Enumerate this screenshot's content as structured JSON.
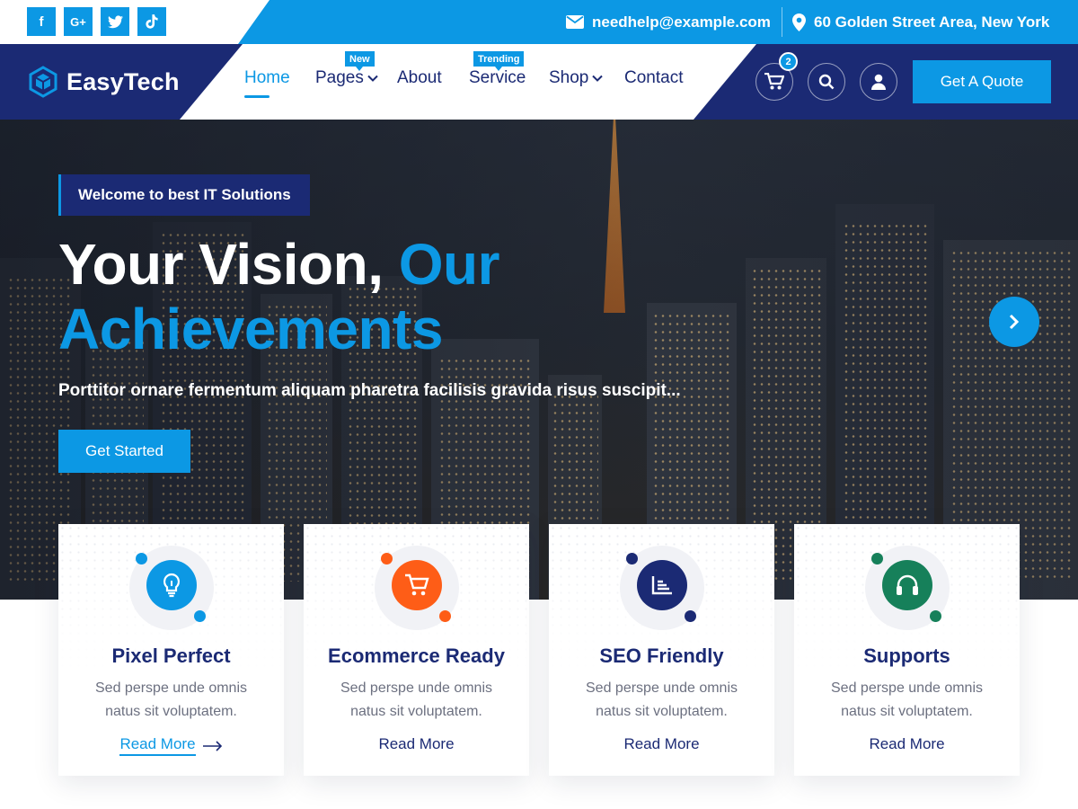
{
  "topbar": {
    "social_icons": [
      "facebook-icon",
      "google-plus-icon",
      "twitter-icon",
      "tiktok-icon"
    ],
    "social_labels": {
      "facebook": "f",
      "google": "G+"
    },
    "email": "needhelp@example.com",
    "address": "60 Golden Street Area, New York"
  },
  "nav": {
    "logo_text": "EasyTech",
    "items": [
      {
        "label": "Home",
        "active": true
      },
      {
        "label": "Pages",
        "badge": "New",
        "dropdown": true
      },
      {
        "label": "About"
      },
      {
        "label": "Service",
        "badge": "Trending"
      },
      {
        "label": "Shop",
        "dropdown": true
      },
      {
        "label": "Contact"
      }
    ],
    "cart_count": "2",
    "quote_button": "Get A Quote"
  },
  "hero": {
    "badge": "Welcome to best IT Solutions",
    "headline_white": "Your Vision,",
    "headline_blue_1": "Our",
    "headline_blue_2": "Achievements",
    "subtitle": "Porttitor ornare fermentum aliquam pharetra facilisis gravida risus suscipit...",
    "cta": "Get Started"
  },
  "features": [
    {
      "title": "Pixel Perfect",
      "desc": "Sed perspe unde omnis natus sit voluptatem.",
      "link": "Read More",
      "icon": "lightbulb-icon",
      "color": "#0c98e4"
    },
    {
      "title": "Ecommerce Ready",
      "desc": "Sed perspe unde omnis natus sit voluptatem.",
      "link": "Read More",
      "icon": "cart-icon",
      "color": "#fe5d17"
    },
    {
      "title": "SEO Friendly",
      "desc": "Sed perspe unde omnis natus sit voluptatem.",
      "link": "Read More",
      "icon": "chart-icon",
      "color": "#1b2a74"
    },
    {
      "title": "Supports",
      "desc": "Sed perspe unde omnis natus sit voluptatem.",
      "link": "Read More",
      "icon": "headphones-icon",
      "color": "#16805a"
    }
  ],
  "colors": {
    "primary": "#0c98e4",
    "navy": "#1b2a74",
    "orange": "#fe5d17",
    "green": "#16805a"
  }
}
